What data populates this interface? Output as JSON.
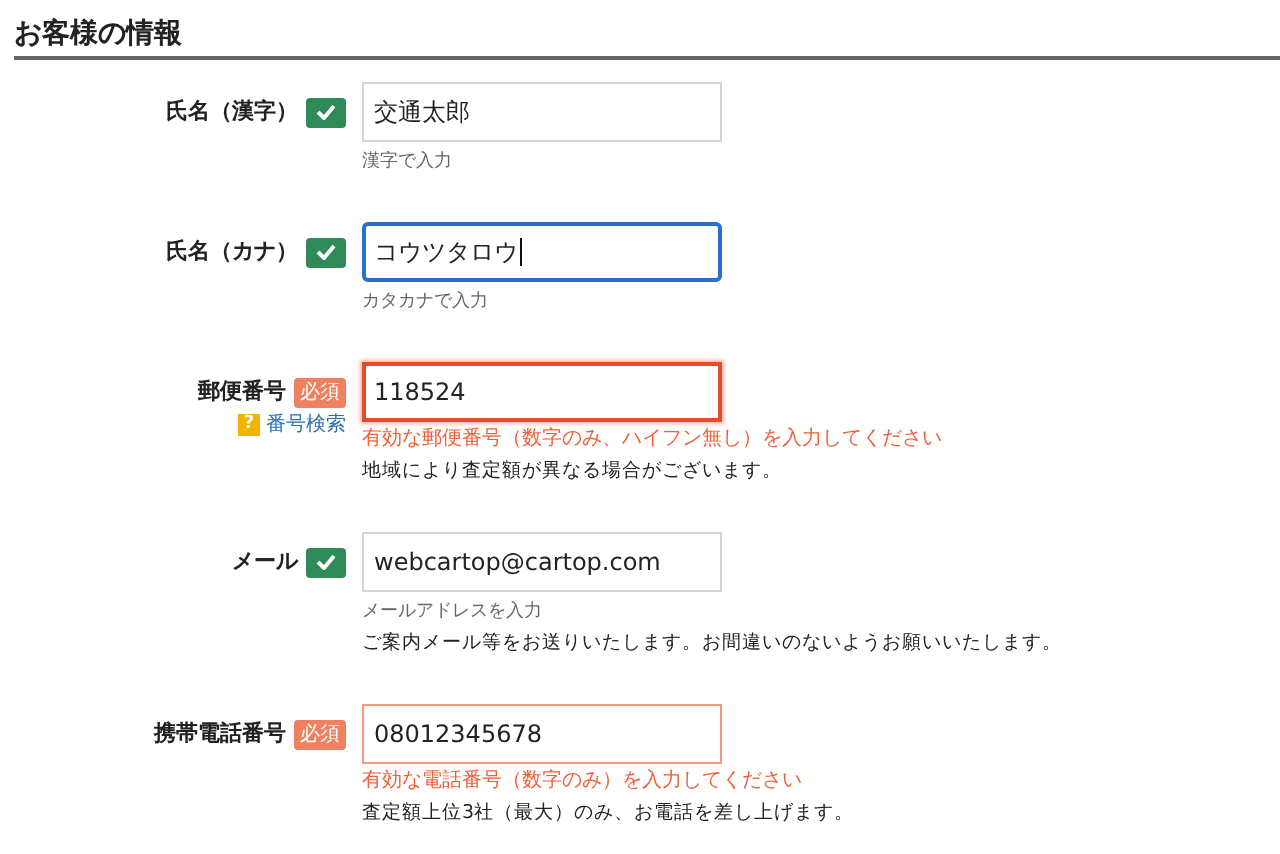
{
  "section": {
    "title": "お客様の情報"
  },
  "fields": [
    {
      "label": "氏名（漢字）",
      "badge": {
        "kind": "valid"
      },
      "value": "交通太郎",
      "focused": false,
      "invalid": false,
      "hint": "漢字で入力"
    },
    {
      "label": "氏名（カナ）",
      "badge": {
        "kind": "valid"
      },
      "value": "コウツタロウ",
      "focused": true,
      "invalid": false,
      "hint": "カタカナで入力"
    },
    {
      "label": "郵便番号",
      "badge": {
        "kind": "required",
        "text": "必須"
      },
      "help_link": {
        "icon": "?",
        "text": "番号検索"
      },
      "value": "118524",
      "focused": true,
      "invalid": true,
      "error": "有効な郵便番号（数字のみ、ハイフン無し）を入力してください",
      "note": "地域により査定額が異なる場合がございます。"
    },
    {
      "label": "メール",
      "badge": {
        "kind": "valid"
      },
      "value": "webcartop@cartop.com",
      "focused": false,
      "invalid": false,
      "hint": "メールアドレスを入力",
      "note": "ご案内メール等をお送りいたします。お間違いのないようお願いいたします。"
    },
    {
      "label": "携帯電話番号",
      "badge": {
        "kind": "required",
        "text": "必須"
      },
      "value": "08012345678",
      "focused": false,
      "invalid": true,
      "error": "有効な電話番号（数字のみ）を入力してください",
      "note": "査定額上位3社（最大）のみ、お電話を差し上げます。"
    }
  ]
}
